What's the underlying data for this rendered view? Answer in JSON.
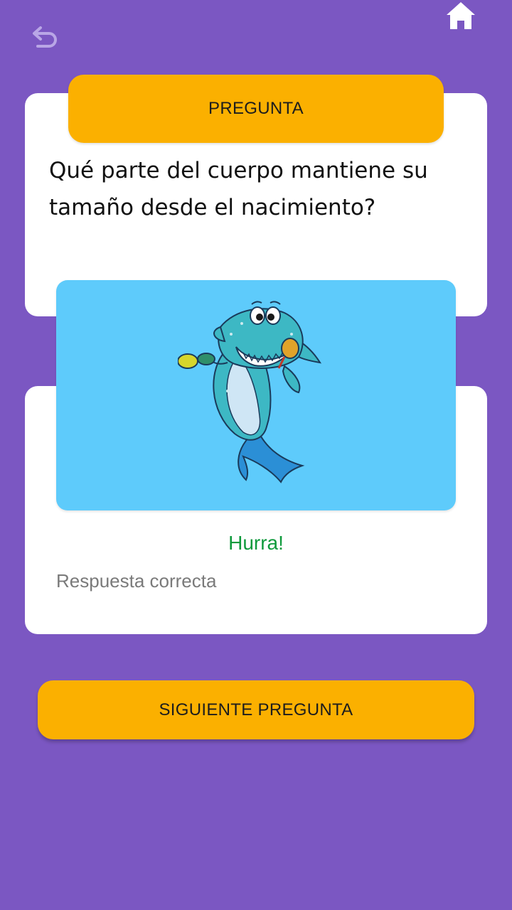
{
  "toolbar": {
    "back_icon": "undo-arrow-icon",
    "home_icon": "home-icon"
  },
  "question": {
    "header_label": "PREGUNTA",
    "text": "Qué parte del cuerpo mantiene su tamaño desde el nacimiento?"
  },
  "result": {
    "image": "cartoon-shark-with-maracas",
    "title": "Hurra!",
    "subtitle": "Respuesta correcta"
  },
  "actions": {
    "next_label": "SIGUIENTE PREGUNTA"
  },
  "colors": {
    "background": "#7b57c2",
    "accent": "#fbb000",
    "success": "#0f9a3c",
    "image_panel": "#5ecbfb"
  }
}
